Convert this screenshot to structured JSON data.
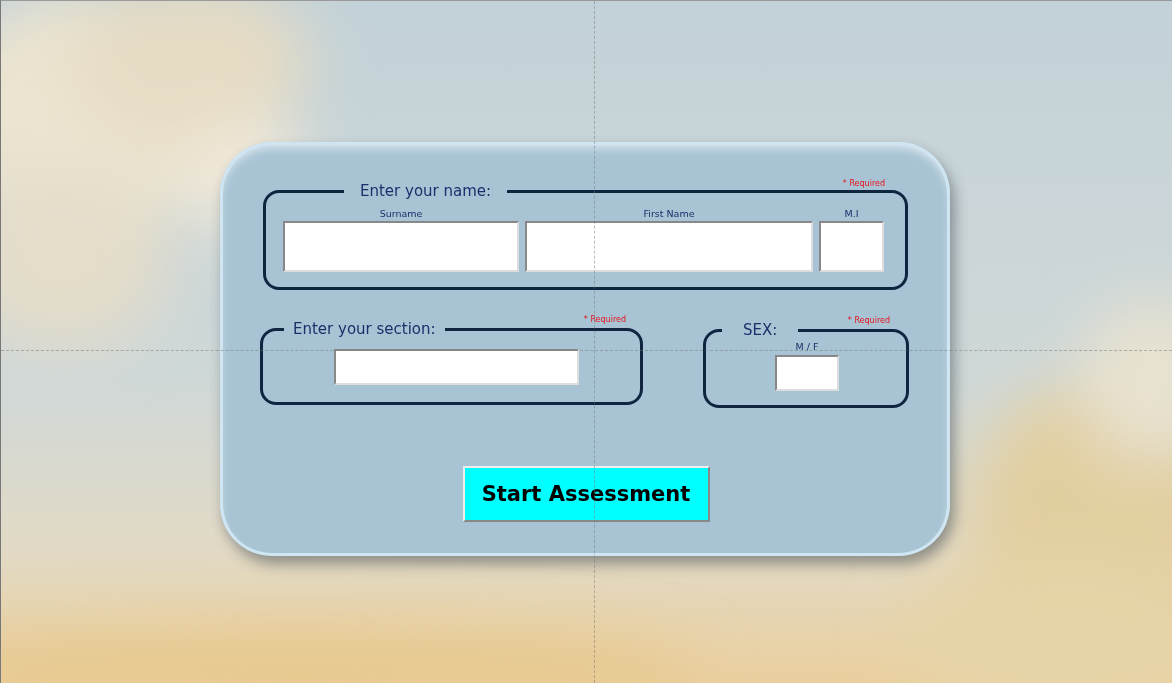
{
  "name_group": {
    "legend": "Enter your name:",
    "required": "* Required",
    "fields": [
      {
        "label": "Surname"
      },
      {
        "label": "First Name"
      },
      {
        "label": "M.I"
      }
    ]
  },
  "section_group": {
    "legend": "Enter your section:",
    "required": "* Required"
  },
  "sex_group": {
    "legend": "SEX:",
    "required": "* Required",
    "hint": "M / F"
  },
  "button": {
    "label": "Start Assessment"
  }
}
